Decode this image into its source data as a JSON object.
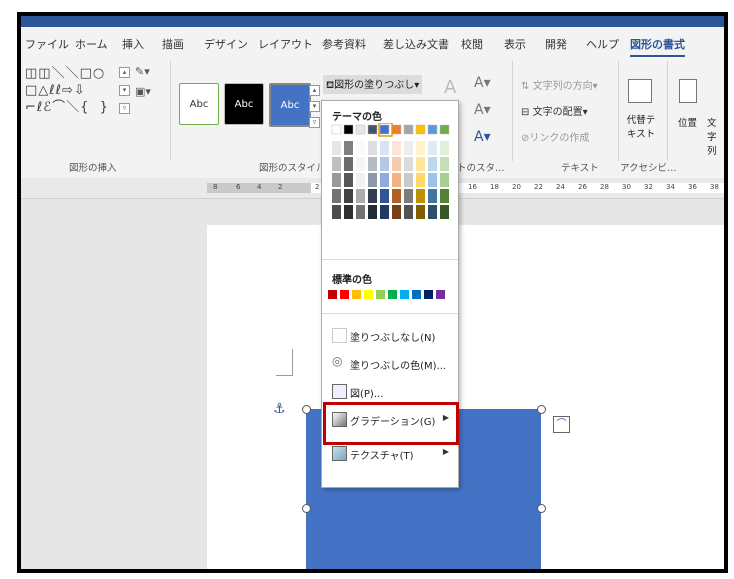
{
  "tabs": [
    "ファイル",
    "ホーム",
    "挿入",
    "描画",
    "デザイン",
    "レイアウト",
    "参考資料",
    "差し込み文書",
    "校閲",
    "表示",
    "開発",
    "ヘルプ",
    "図形の書式"
  ],
  "active_tab": "図形の書式",
  "groups": {
    "insert_shapes": "図形の挿入",
    "shape_styles": "図形のスタイル",
    "wordart_styles": "トのスタ…",
    "text": "テキスト",
    "accessibility": "アクセシビ…"
  },
  "style_sample_text": "Abc",
  "fill_button": "図形の塗りつぶし",
  "text_group": {
    "direction": "文字列の方向",
    "align": "文字の配置",
    "link": "リンクの作成"
  },
  "alt_text": "代替テ キスト",
  "position": "位置",
  "wrap": "文字 列",
  "ruler_numbers": [
    "8",
    "6",
    "4",
    "2",
    "2",
    "16",
    "18",
    "20",
    "22",
    "24",
    "26",
    "28",
    "30",
    "32",
    "34",
    "36",
    "38"
  ],
  "dropdown": {
    "theme_colors_label": "テーマの色",
    "standard_colors_label": "標準の色",
    "no_fill": "塗りつぶしなし(N)",
    "more_colors": "塗りつぶしの色(M)...",
    "picture": "図(P)...",
    "gradient": "グラデーション(G)",
    "texture": "テクスチャ(T)"
  },
  "colors": {
    "accent": "#2b579a",
    "shape_fill": "#4472c4",
    "highlight": "#c00000",
    "theme_top": [
      "#ffffff",
      "#000000",
      "#e7e6e6",
      "#44546a",
      "#4472c4",
      "#ed7d31",
      "#a5a5a5",
      "#ffc000",
      "#5b9bd5",
      "#70ad47"
    ],
    "standard": [
      "#c00000",
      "#ff0000",
      "#ffc000",
      "#ffff00",
      "#92d050",
      "#00b050",
      "#00b0f0",
      "#0070c0",
      "#002060",
      "#7030a0"
    ]
  }
}
